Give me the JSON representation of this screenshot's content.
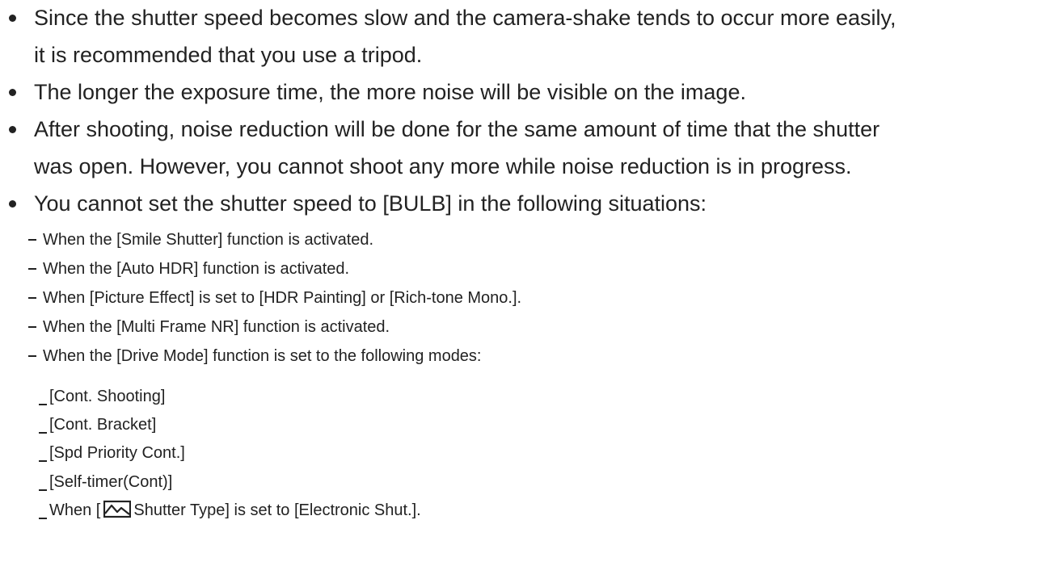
{
  "notes": {
    "bullets": [
      {
        "line1": "Since the shutter speed becomes slow and the camera-shake tends to occur more easily,",
        "line2": "it is recommended that you use a tripod."
      },
      {
        "line1": "The longer the exposure time, the more noise will be visible on the image."
      },
      {
        "line1": "After shooting, noise reduction will be done for the same amount of time that the shutter",
        "line2": "was open. However, you cannot shoot any more while noise reduction is in progress."
      },
      {
        "line1": "You cannot set the shutter speed to [BULB] in the following situations:"
      }
    ],
    "situations": [
      "When the [Smile Shutter] function is activated.",
      "When the [Auto HDR] function is activated.",
      "When [Picture Effect] is set to [HDR Painting] or [Rich-tone Mono.].",
      "When the [Multi Frame NR] function is activated.",
      "When the [Drive Mode] function is set to the following modes:"
    ],
    "drive_modes": [
      "[Cont. Shooting]",
      "[Cont. Bracket]",
      "[Spd Priority Cont.]",
      "[Self-timer(Cont)]"
    ],
    "shutter_type": {
      "prefix": "When [",
      "suffix": "Shutter Type] is set to [Electronic Shut.].",
      "icon": "camera-still-icon"
    }
  }
}
